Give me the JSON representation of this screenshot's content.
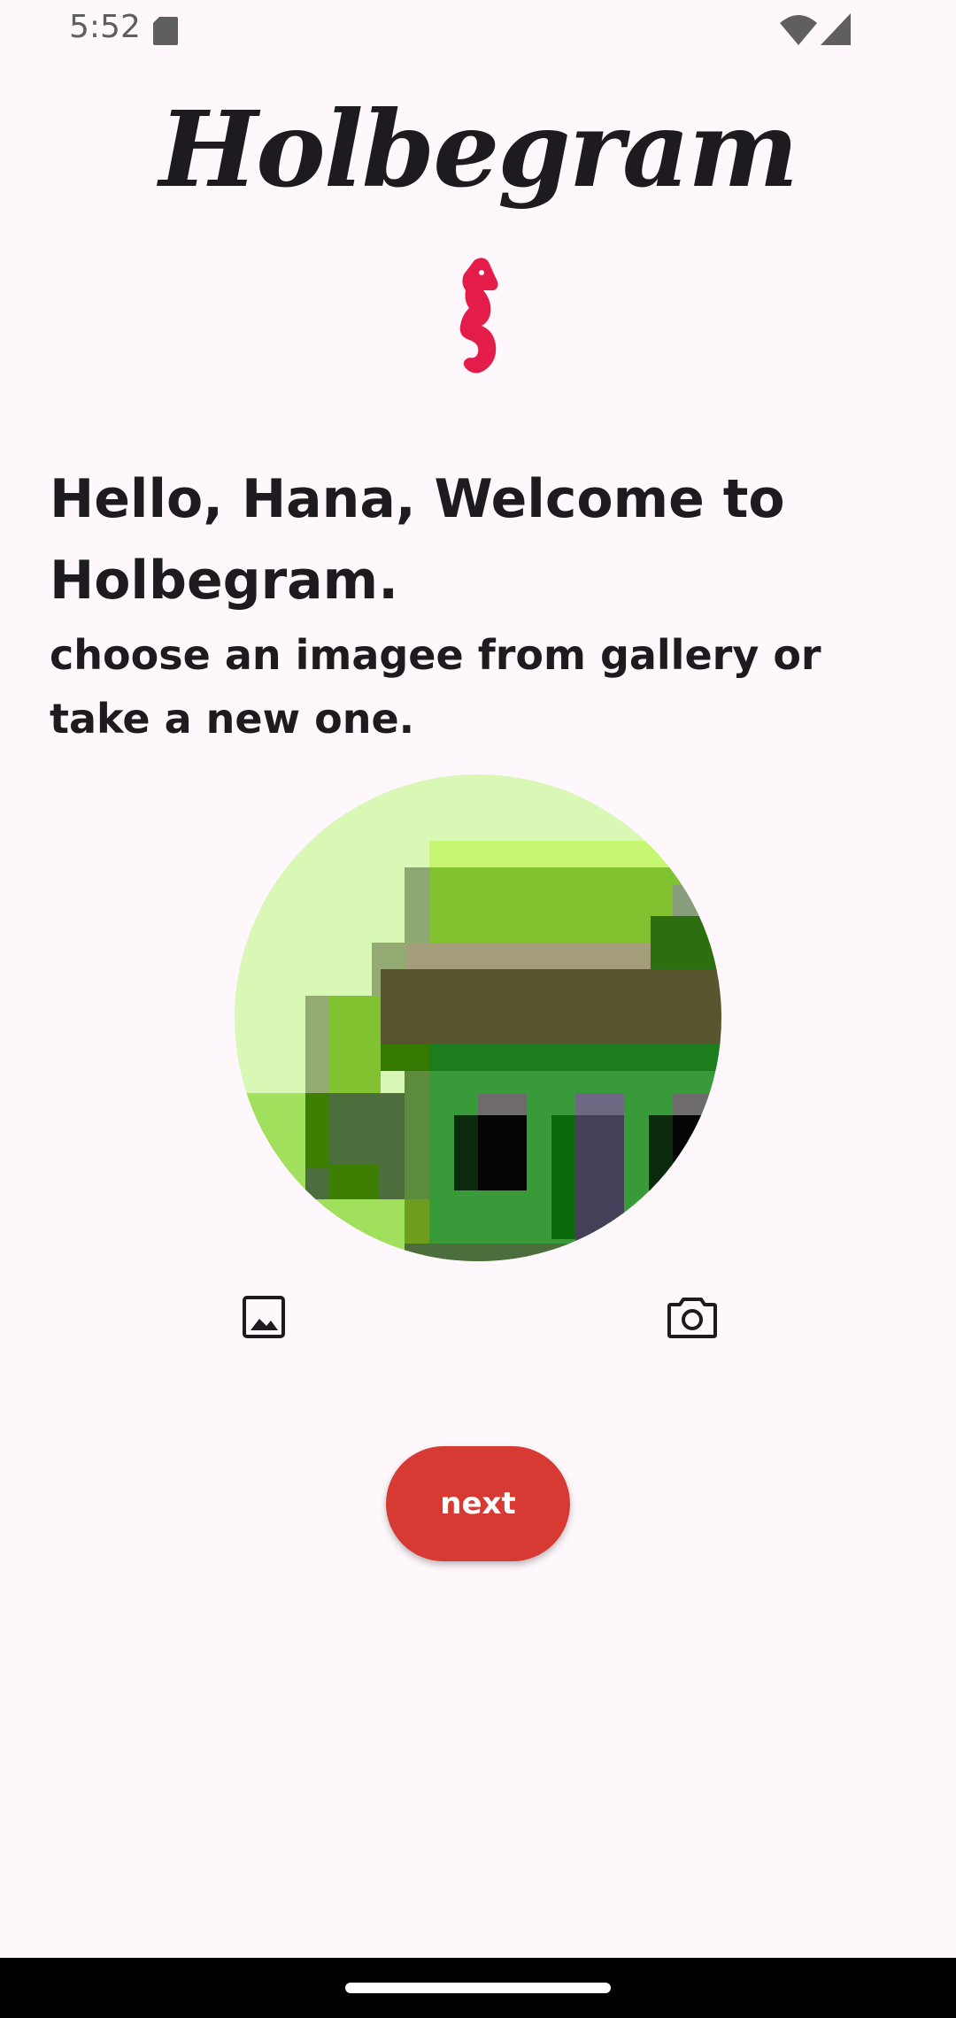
{
  "status_bar": {
    "time": "5:52",
    "icons": [
      "sd-card-icon",
      "wifi-icon",
      "cell-signal-icon"
    ]
  },
  "header": {
    "wordmark": "Holbegram",
    "logo": "seahorse-logo"
  },
  "main": {
    "greeting": "Hello, Hana, Welcome to Holbegram.",
    "instruction": "choose an imagee from gallery or take a new one.",
    "avatar": "profile-image-avatar",
    "gallery_icon": "image-icon",
    "camera_icon": "camera-icon",
    "next_label": "next"
  },
  "colors": {
    "background": "#fef7fb",
    "accent": "#d63a33",
    "logo": "#e31c4a",
    "text": "#1d1b20"
  }
}
